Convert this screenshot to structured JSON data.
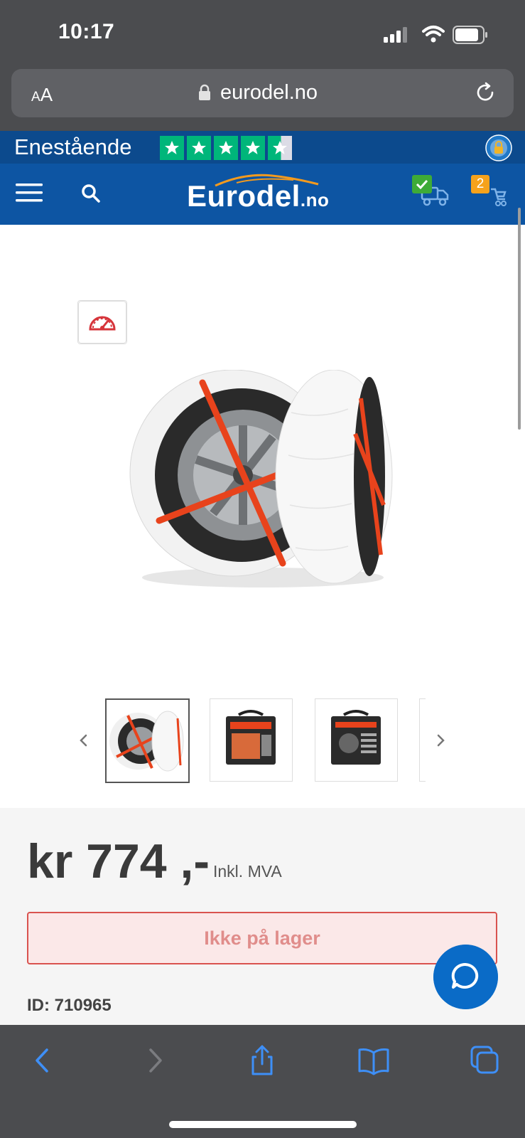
{
  "status_bar": {
    "time": "10:17"
  },
  "browser": {
    "text_size_label": "AA",
    "url": "eurodel.no"
  },
  "trustpilot": {
    "label": "Enestående",
    "rating_stars": 4.5
  },
  "header": {
    "logo_name": "Eurodel",
    "logo_tld": ".no",
    "cart_count": "2"
  },
  "product": {
    "price": "kr 774 ,-",
    "vat_label": "Inkl. MVA",
    "stock_status": "Ikke på lager",
    "id_label": "ID: 710965"
  },
  "colors": {
    "brand_blue": "#0d55a3",
    "trust_green": "#00b67a",
    "out_of_stock_red": "#d9534f",
    "cart_badge": "#f6a21b"
  }
}
